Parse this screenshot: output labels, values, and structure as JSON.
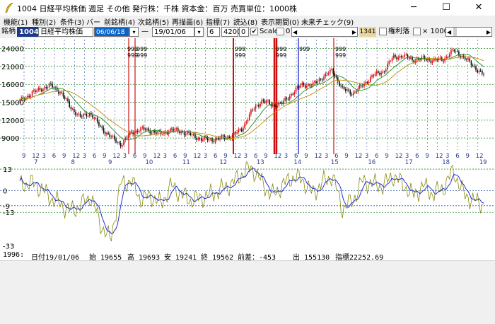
{
  "window": {
    "title": "1004 日経平均株価 週足 その他 発行株：千株 資本金：百万 売買単位：1000株",
    "minimize": "─",
    "maximize": "☐",
    "close": "✕"
  },
  "menu": [
    "機能(1)",
    "種別(2)",
    "条件(3)",
    "バー",
    "前銘柄(4)",
    "次銘柄(5)",
    "再描画(6)",
    "指標(7)",
    "読込(8)",
    "表示期間(0)",
    "未来チェック(9)"
  ],
  "toolbar": {
    "symbol_label": "銘柄",
    "code": "1004",
    "name": "日経平均株価",
    "start_date": "06/06/18",
    "dash": "—",
    "end_date": "19/01/06",
    "period": "6",
    "value1": "4200",
    "value2": "0",
    "scale_label": "Scale",
    "scale_value": "0",
    "code_box": "1341",
    "rights_label": "権利落",
    "times_label": "× 1000"
  },
  "chart_data": [
    {
      "type": "line",
      "series": [
        {
          "values": [
            15200,
            16300,
            17200,
            17800,
            16800,
            14200,
            12500,
            13200,
            10800,
            9200,
            7900,
            9800,
            10500,
            10200,
            9700,
            10400,
            10100,
            9500,
            8800,
            8700,
            9000,
            9300,
            10500,
            13500,
            15300,
            14500,
            14800,
            16500,
            18000,
            17800,
            19200,
            20300,
            17200,
            16500,
            17800,
            19500,
            20100,
            22500,
            22800,
            22100,
            22300,
            22000,
            22200,
            23700,
            22600,
            21000,
            19600
          ]
        }
      ],
      "y_ticks": [
        24000,
        21000,
        18000,
        15000,
        12000,
        9000
      ],
      "y_labels": [
        "24000",
        "21000",
        "16000",
        "15000",
        "12000",
        "9000"
      ],
      "x_months": [
        "9",
        "12",
        "3",
        "6",
        "9",
        "12",
        "3",
        "6",
        "9",
        "12",
        "3",
        "6",
        "9",
        "12",
        "3",
        "6",
        "9",
        "12",
        "3",
        "6",
        "9",
        "12",
        "3",
        "6",
        "9",
        "12",
        "3",
        "6",
        "9",
        "12",
        "3",
        "6",
        "9",
        "12",
        "3",
        "6",
        "9",
        "12",
        "3",
        "6",
        "9",
        "12",
        "3",
        "6",
        "9",
        "12"
      ],
      "x_years": [
        "7",
        "8",
        "9",
        "10",
        "11",
        "12",
        "13",
        "14",
        "15",
        "16",
        "17",
        "18",
        "19"
      ],
      "marker_text": "999"
    },
    {
      "type": "line",
      "series": [
        {
          "values": [
            3,
            5,
            2,
            -4,
            -8,
            -12,
            -9,
            -3,
            -20,
            -30,
            4,
            6,
            -5,
            -3,
            -8,
            3,
            -2,
            -6,
            -4,
            -2,
            1,
            4,
            10,
            14,
            5,
            -3,
            3,
            8,
            7,
            -2,
            5,
            9,
            -11,
            -6,
            6,
            4,
            3,
            9,
            4,
            -3,
            3,
            -2,
            2,
            12,
            -2,
            -6,
            -8
          ]
        }
      ],
      "y_labels": [
        "13",
        "0",
        "-9",
        "-13",
        "-33"
      ]
    }
  ],
  "status": {
    "count": "1996:",
    "date": "日付19/01/06",
    "open": "始 19655",
    "high": "高 19693",
    "low": "安 19241",
    "close": "終 19562",
    "change": "前差：-453",
    "volume": "出 155130",
    "indicator": "指標22252.69"
  }
}
